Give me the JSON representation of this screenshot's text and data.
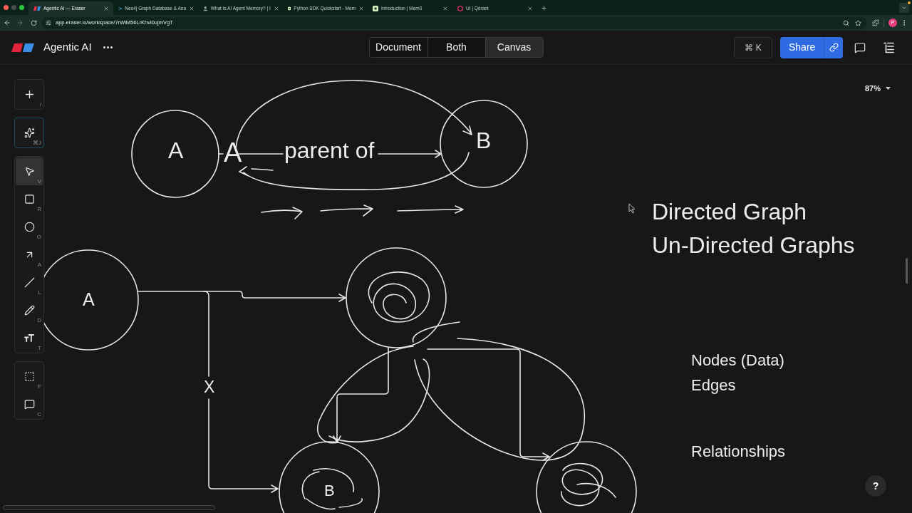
{
  "browser": {
    "tabs": [
      {
        "kind": "eraser",
        "title": "Agentic AI — Eraser",
        "selected": true
      },
      {
        "kind": "neo4j",
        "title": "Neo4j Graph Database & Ana",
        "selected": false
      },
      {
        "kind": "person",
        "title": "What Is AI Agent Memory? | I",
        "selected": false
      },
      {
        "kind": "mem0",
        "title": "Python SDK Quickstart - Mem",
        "selected": false
      },
      {
        "kind": "mem0",
        "title": "Introduction | Mem0",
        "selected": false
      },
      {
        "kind": "qdrant",
        "title": "UI | Qdrant",
        "selected": false
      }
    ],
    "url": "app.eraser.io/workspace/7rWiM56LrKhvl0ujmVgT",
    "profile_initial": "P"
  },
  "header": {
    "title": "Agentic AI",
    "view_modes": [
      {
        "label": "Document",
        "selected": false
      },
      {
        "label": "Both",
        "selected": false
      },
      {
        "label": "Canvas",
        "selected": true
      }
    ],
    "command_shortcut": "⌘ K",
    "share": "Share"
  },
  "toolbar": {
    "groups": [
      {
        "kind": "plain",
        "tools": [
          {
            "kind": "add",
            "shortcut": "/",
            "selected": false
          }
        ]
      },
      {
        "kind": "highlight",
        "tools": [
          {
            "kind": "ai",
            "shortcut": "⌘J",
            "selected": false
          }
        ]
      },
      {
        "kind": "plain",
        "tools": [
          {
            "kind": "select",
            "shortcut": "V",
            "selected": true
          },
          {
            "kind": "rectangle",
            "shortcut": "R",
            "selected": false
          },
          {
            "kind": "ellipse",
            "shortcut": "O",
            "selected": false
          },
          {
            "kind": "arrow",
            "shortcut": "A",
            "selected": false
          },
          {
            "kind": "line",
            "shortcut": "L",
            "selected": false
          },
          {
            "kind": "pencil",
            "shortcut": "D",
            "selected": false
          },
          {
            "kind": "text",
            "shortcut": "T",
            "selected": false
          }
        ]
      },
      {
        "kind": "plain",
        "tools": [
          {
            "kind": "frame",
            "shortcut": "F",
            "selected": false
          },
          {
            "kind": "comment",
            "shortcut": "C",
            "selected": false
          }
        ]
      }
    ]
  },
  "zoom": "87%",
  "canvas": {
    "sketch_1": {
      "node_a": "A",
      "edge_source": "A",
      "edge_label": "parent of",
      "node_b": "B"
    },
    "notes": [
      "Directed Graph",
      "Un-Directed Graphs"
    ],
    "sketch_2": {
      "node_a": "A",
      "edge_label": "X",
      "node_b": "B"
    },
    "terms": [
      "Nodes (Data)",
      "Edges",
      "Relationships"
    ]
  },
  "help": "?"
}
